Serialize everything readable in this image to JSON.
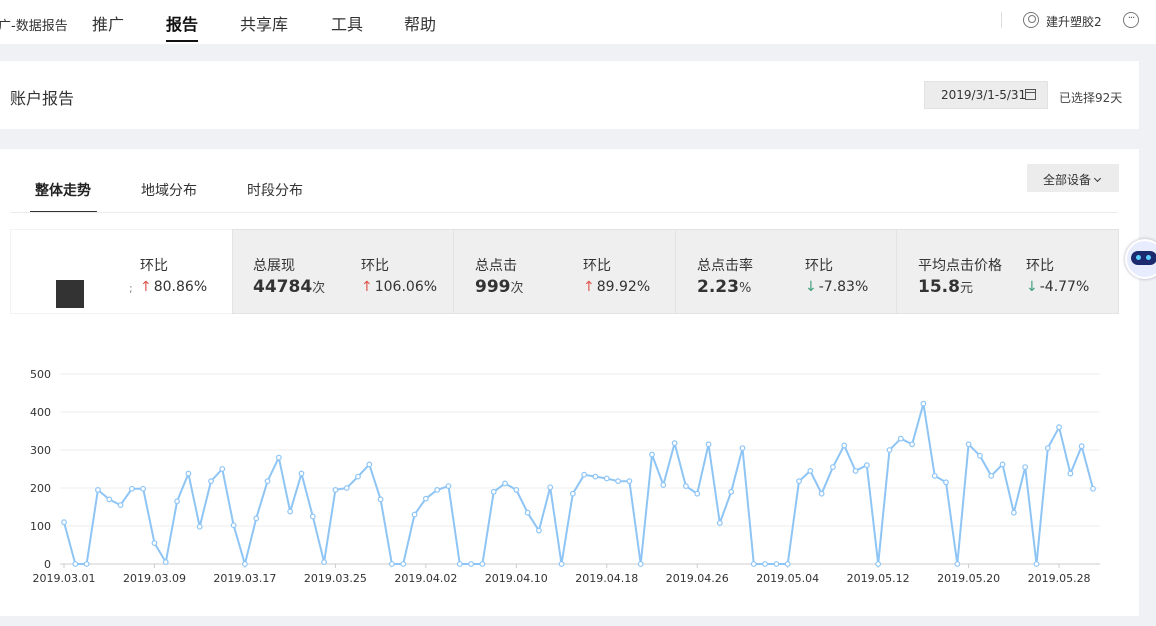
{
  "nav": {
    "brand": "广-数据报告",
    "items": [
      "推广",
      "报告",
      "共享库",
      "工具",
      "帮助"
    ],
    "active": "报告",
    "user": "建升塑胶2"
  },
  "header": {
    "title": "账户报告",
    "date_range": "2019/3/1-5/31",
    "selected_days": "已选择92天"
  },
  "tabs": [
    "整体走势",
    "地域分布",
    "时段分布"
  ],
  "device_filter": "全部设备",
  "metrics": [
    {
      "label": "",
      "value": "",
      "unit": "",
      "change_label": "环比",
      "change": "80.86%",
      "direction": "up"
    },
    {
      "label": "总展现",
      "value": "44784",
      "unit": "次",
      "change_label": "环比",
      "change": "106.06%",
      "direction": "up"
    },
    {
      "label": "总点击",
      "value": "999",
      "unit": "次",
      "change_label": "环比",
      "change": "89.92%",
      "direction": "up"
    },
    {
      "label": "总点击率",
      "value": "2.23",
      "unit": "%",
      "change_label": "环比",
      "change": "-7.83%",
      "direction": "down"
    },
    {
      "label": "平均点击价格",
      "value": "15.8",
      "unit": "元",
      "change_label": "环比",
      "change": "-4.77%",
      "direction": "down"
    }
  ],
  "colors": {
    "line": "#8ec5f5",
    "up": "#e0564b",
    "down": "#3f9f7a"
  },
  "chart_data": {
    "type": "line",
    "ylim": [
      0,
      500
    ],
    "yticks": [
      0,
      100,
      200,
      300,
      400,
      500
    ],
    "xtick_labels": [
      "2019.03.01",
      "2019.03.09",
      "2019.03.17",
      "2019.03.25",
      "2019.04.02",
      "2019.04.10",
      "2019.04.18",
      "2019.04.26",
      "2019.05.04",
      "2019.05.12",
      "2019.05.20",
      "2019.05.28"
    ],
    "grid": true,
    "series": [
      {
        "values": [
          110,
          0,
          0,
          195,
          170,
          155,
          198,
          198,
          55,
          5,
          165,
          238,
          98,
          218,
          250,
          102,
          0,
          120,
          218,
          280,
          138,
          238,
          125,
          5,
          195,
          200,
          230,
          262,
          170,
          0,
          0,
          130,
          172,
          195,
          205,
          0,
          0,
          0,
          190,
          212,
          195,
          135,
          88,
          202,
          0,
          185,
          235,
          230,
          225,
          218,
          218,
          0,
          288,
          208,
          318,
          205,
          185,
          315,
          108,
          190,
          305,
          0,
          0,
          0,
          0,
          218,
          245,
          185,
          255,
          312,
          245,
          260,
          0,
          300,
          330,
          315,
          422,
          232,
          215,
          0,
          315,
          285,
          232,
          262,
          135,
          255,
          0,
          305,
          360,
          238,
          310,
          198
        ]
      }
    ]
  }
}
